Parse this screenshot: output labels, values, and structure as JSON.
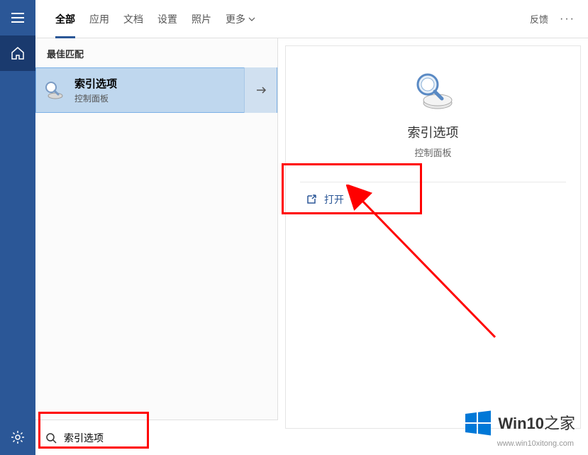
{
  "rail": {
    "menu": "menu",
    "home": "home",
    "settings": "settings"
  },
  "header": {
    "tabs": {
      "all": "全部",
      "apps": "应用",
      "docs": "文档",
      "settings": "设置",
      "photos": "照片",
      "more": "更多"
    },
    "feedback": "反馈",
    "ellipsis": "···"
  },
  "results": {
    "best_match_header": "最佳匹配",
    "item": {
      "title": "索引选项",
      "subtitle": "控制面板"
    }
  },
  "preview": {
    "title": "索引选项",
    "subtitle": "控制面板",
    "open_label": "打开"
  },
  "search": {
    "query": "索引选项"
  },
  "watermark": {
    "brand_prefix": "Win10",
    "brand_suffix": "之家",
    "url": "www.win10xitong.com"
  }
}
